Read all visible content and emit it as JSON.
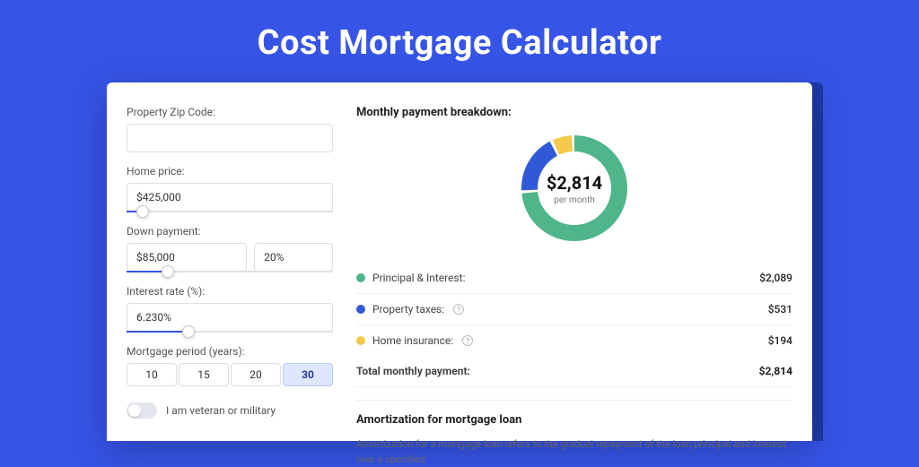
{
  "title": "Cost Mortgage Calculator",
  "form": {
    "zip_label": "Property Zip Code:",
    "zip_value": "",
    "home_price_label": "Home price:",
    "home_price_value": "$425,000",
    "home_price_slider_pct": 8,
    "down_payment_label": "Down payment:",
    "down_payment_value": "$85,000",
    "down_payment_pct_value": "20%",
    "down_payment_slider_pct": 20,
    "interest_label": "Interest rate (%):",
    "interest_value": "6.230%",
    "interest_slider_pct": 30,
    "period_label": "Mortgage period (years):",
    "period_options": [
      "10",
      "15",
      "20",
      "30"
    ],
    "period_selected": "30",
    "veteran_label": "I am veteran or military",
    "veteran_on": false
  },
  "breakdown": {
    "title": "Monthly payment breakdown:",
    "center_value": "$2,814",
    "center_sub": "per month",
    "rows": [
      {
        "label": "Principal & Interest:",
        "value": "$2,089",
        "color": "#4fb58a",
        "info": false
      },
      {
        "label": "Property taxes:",
        "value": "$531",
        "color": "#2f59d6",
        "info": true
      },
      {
        "label": "Home insurance:",
        "value": "$194",
        "color": "#f4c94e",
        "info": true
      }
    ],
    "total_label": "Total monthly payment:",
    "total_value": "$2,814"
  },
  "chart_data": {
    "type": "pie",
    "title": "Monthly payment breakdown",
    "total": 2814,
    "series": [
      {
        "name": "Principal & Interest",
        "value": 2089,
        "color": "#4fb58a"
      },
      {
        "name": "Property taxes",
        "value": 531,
        "color": "#2f59d6"
      },
      {
        "name": "Home insurance",
        "value": 194,
        "color": "#f4c94e"
      }
    ]
  },
  "amort": {
    "title": "Amortization for mortgage loan",
    "text": "Amortization for a mortgage loan refers to the gradual repayment of the loan principal and interest over a specified"
  }
}
